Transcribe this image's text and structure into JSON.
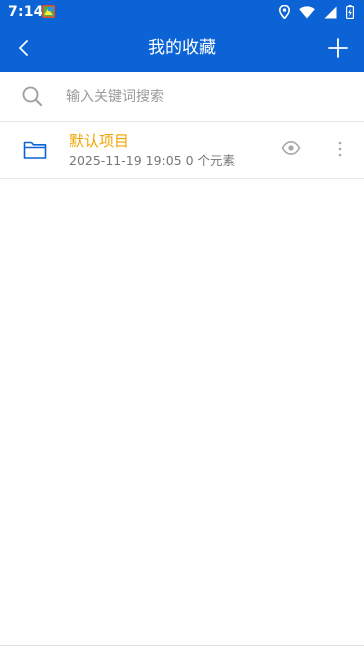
{
  "status_bar": {
    "time": "7:14",
    "icons": [
      "app-notification-icon",
      "location-icon",
      "wifi-icon",
      "signal-icon",
      "battery-charging-icon"
    ]
  },
  "app_bar": {
    "title": "我的收藏",
    "back_icon": "chevron-left-icon",
    "add_icon": "plus-icon",
    "color": "#0b63d6"
  },
  "search": {
    "placeholder": "输入关键词搜索",
    "value": ""
  },
  "items": [
    {
      "name": "默认项目",
      "meta": "2025-11-19 19:05 0 个元素",
      "name_color": "#f0a500",
      "icon": "folder-icon"
    }
  ]
}
